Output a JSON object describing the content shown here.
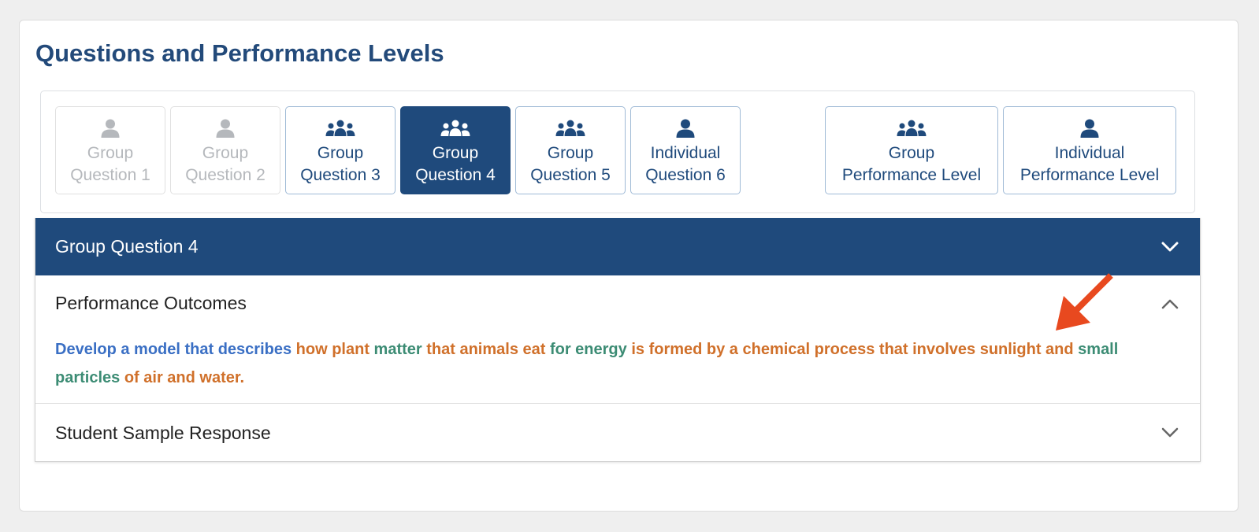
{
  "page_title": "Questions and Performance Levels",
  "tabs": [
    {
      "line1": "Group",
      "line2": "Question 1",
      "icon": "person-icon",
      "state": "disabled"
    },
    {
      "line1": "Group",
      "line2": "Question 2",
      "icon": "person-icon",
      "state": "disabled"
    },
    {
      "line1": "Group",
      "line2": "Question 3",
      "icon": "group-icon",
      "state": "normal"
    },
    {
      "line1": "Group",
      "line2": "Question 4",
      "icon": "group-icon",
      "state": "active"
    },
    {
      "line1": "Group",
      "line2": "Question 5",
      "icon": "group-icon",
      "state": "normal"
    },
    {
      "line1": "Individual",
      "line2": "Question 6",
      "icon": "person-icon",
      "state": "normal"
    },
    {
      "line1": "Group",
      "line2": "Performance Level",
      "icon": "group-icon",
      "state": "normal"
    },
    {
      "line1": "Individual",
      "line2": "Performance Level",
      "icon": "person-icon",
      "state": "normal"
    }
  ],
  "accordion": {
    "header": "Group Question 4",
    "performance_outcomes": {
      "title": "Performance Outcomes",
      "segments": [
        {
          "text": "Develop a model that describes ",
          "color": "#3a6fc4"
        },
        {
          "text": "how plant ",
          "color": "#d0702a"
        },
        {
          "text": "matter ",
          "color": "#3c8c74"
        },
        {
          "text": "that animals eat ",
          "color": "#d0702a"
        },
        {
          "text": "for energy ",
          "color": "#3c8c74"
        },
        {
          "text": "is formed by a chemical process that involves sunlight and ",
          "color": "#d0702a"
        },
        {
          "text": "small particles ",
          "color": "#3c8c74"
        },
        {
          "text": "of air and water.",
          "color": "#d0702a"
        }
      ]
    },
    "student_sample": {
      "title": "Student Sample Response"
    }
  },
  "colors": {
    "primary": "#1f4a7c",
    "annotation_arrow": "#e8491f",
    "disabled": "#b5b8bc"
  }
}
